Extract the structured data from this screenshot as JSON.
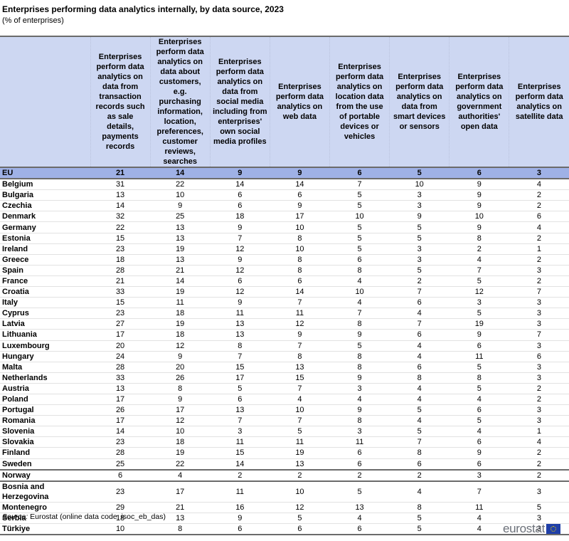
{
  "header": {
    "title": "Enterprises performing data analytics internally, by data source, 2023",
    "subtitle": "(% of enterprises)"
  },
  "chart_data": {
    "type": "table",
    "title": "Enterprises performing data analytics internally, by data source, 2023",
    "unit": "% of enterprises",
    "columns": [
      "",
      "Enterprises perform data analytics on data from transaction records such as sale details, payments records",
      "Enterprises perform data analytics on data about customers, e.g. purchasing information, location, preferences, customer reviews, searches",
      "Enterprises perform data analytics on data from social media including from enterprises' own social media profiles",
      "Enterprises perform data analytics on web data",
      "Enterprises perform data analytics on location data from the use of portable devices or vehicles",
      "Enterprises perform data analytics on data from smart devices or sensors",
      "Enterprises perform data analytics on government authorities' open data",
      "Enterprises perform data analytics on satellite data"
    ],
    "rows": [
      {
        "label": "EU",
        "values": [
          21,
          14,
          9,
          9,
          6,
          5,
          6,
          3
        ]
      },
      {
        "label": "Belgium",
        "values": [
          31,
          22,
          14,
          14,
          7,
          10,
          9,
          4
        ]
      },
      {
        "label": "Bulgaria",
        "values": [
          13,
          10,
          6,
          6,
          5,
          3,
          9,
          2
        ]
      },
      {
        "label": "Czechia",
        "values": [
          14,
          9,
          6,
          9,
          5,
          3,
          9,
          2
        ]
      },
      {
        "label": "Denmark",
        "values": [
          32,
          25,
          18,
          17,
          10,
          9,
          10,
          6
        ]
      },
      {
        "label": "Germany",
        "values": [
          22,
          13,
          9,
          10,
          5,
          5,
          9,
          4
        ]
      },
      {
        "label": "Estonia",
        "values": [
          15,
          13,
          7,
          8,
          5,
          5,
          8,
          2
        ]
      },
      {
        "label": "Ireland",
        "values": [
          23,
          19,
          12,
          10,
          5,
          3,
          2,
          1
        ]
      },
      {
        "label": "Greece",
        "values": [
          18,
          13,
          9,
          8,
          6,
          3,
          4,
          2
        ]
      },
      {
        "label": "Spain",
        "values": [
          28,
          21,
          12,
          8,
          8,
          5,
          7,
          3
        ]
      },
      {
        "label": "France",
        "values": [
          21,
          14,
          6,
          6,
          4,
          2,
          5,
          2
        ]
      },
      {
        "label": "Croatia",
        "values": [
          33,
          19,
          12,
          14,
          10,
          7,
          12,
          7
        ]
      },
      {
        "label": "Italy",
        "values": [
          15,
          11,
          9,
          7,
          4,
          6,
          3,
          3
        ]
      },
      {
        "label": "Cyprus",
        "values": [
          23,
          18,
          11,
          11,
          7,
          4,
          5,
          3
        ]
      },
      {
        "label": "Latvia",
        "values": [
          27,
          19,
          13,
          12,
          8,
          7,
          19,
          3
        ]
      },
      {
        "label": "Lithuania",
        "values": [
          17,
          18,
          13,
          9,
          9,
          6,
          9,
          7
        ]
      },
      {
        "label": "Luxembourg",
        "values": [
          20,
          12,
          8,
          7,
          5,
          4,
          6,
          3
        ]
      },
      {
        "label": "Hungary",
        "values": [
          24,
          9,
          7,
          8,
          8,
          4,
          11,
          6
        ]
      },
      {
        "label": "Malta",
        "values": [
          28,
          20,
          15,
          13,
          8,
          6,
          5,
          3
        ]
      },
      {
        "label": "Netherlands",
        "values": [
          33,
          26,
          17,
          15,
          9,
          8,
          8,
          3
        ]
      },
      {
        "label": "Austria",
        "values": [
          13,
          8,
          5,
          7,
          3,
          4,
          5,
          2
        ]
      },
      {
        "label": "Poland",
        "values": [
          17,
          9,
          6,
          4,
          4,
          4,
          4,
          2
        ]
      },
      {
        "label": "Portugal",
        "values": [
          26,
          17,
          13,
          10,
          9,
          5,
          6,
          3
        ]
      },
      {
        "label": "Romania",
        "values": [
          17,
          12,
          7,
          7,
          8,
          4,
          5,
          3
        ]
      },
      {
        "label": "Slovenia",
        "values": [
          14,
          10,
          3,
          5,
          3,
          5,
          4,
          1
        ]
      },
      {
        "label": "Slovakia",
        "values": [
          23,
          18,
          11,
          11,
          11,
          7,
          6,
          4
        ]
      },
      {
        "label": "Finland",
        "values": [
          28,
          19,
          15,
          19,
          6,
          8,
          9,
          2
        ]
      },
      {
        "label": "Sweden",
        "values": [
          25,
          22,
          14,
          13,
          6,
          6,
          6,
          2
        ]
      },
      {
        "label": "Norway",
        "values": [
          6,
          4,
          2,
          2,
          2,
          2,
          3,
          2
        ]
      },
      {
        "label": "Bosnia and Herzegovina",
        "values": [
          23,
          17,
          11,
          10,
          5,
          4,
          7,
          3
        ]
      },
      {
        "label": "Montenegro",
        "values": [
          29,
          21,
          16,
          12,
          13,
          8,
          11,
          5
        ]
      },
      {
        "label": "Serbia",
        "values": [
          18,
          13,
          9,
          5,
          4,
          5,
          4,
          3
        ]
      },
      {
        "label": "Türkiye",
        "values": [
          10,
          8,
          6,
          6,
          6,
          5,
          4,
          3
        ]
      }
    ]
  },
  "footer": {
    "source_label": "Source:",
    "source_text": "Eurostat (online data code: isoc_eb_das)",
    "logo_text": "eurostat"
  }
}
